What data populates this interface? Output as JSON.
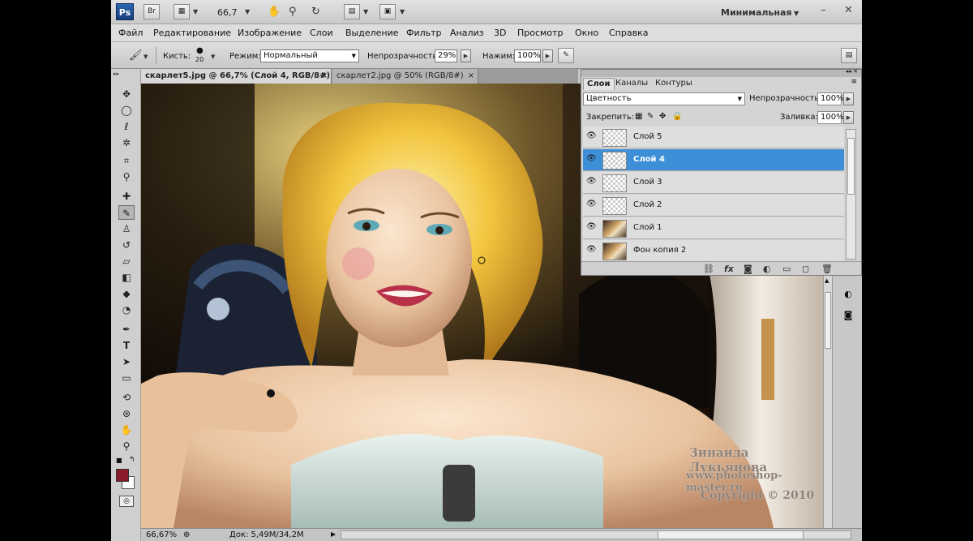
{
  "app": {
    "logo": "Ps",
    "bridge": "Br",
    "zoom": "66,7",
    "workspace": "Минимальная",
    "win_minimize": "–",
    "win_close": "✕"
  },
  "menu": [
    "Файл",
    "Редактирование",
    "Изображение",
    "Слои",
    "Выделение",
    "Фильтр",
    "Анализ",
    "3D",
    "Просмотр",
    "Окно",
    "Справка"
  ],
  "options": {
    "brush_label": "Кисть:",
    "brush_size": "20",
    "mode_label": "Режим:",
    "mode_value": "Нормальный",
    "opacity_label": "Непрозрачность:",
    "opacity_value": "29%",
    "flow_label": "Нажим:",
    "flow_value": "100%"
  },
  "doc_tabs": [
    {
      "label": "скарлет5.jpg @ 66,7% (Слой 4, RGB/8#) *",
      "close": "×"
    },
    {
      "label": "скарлет2.jpg @ 50% (RGB/8#)",
      "close": "×"
    }
  ],
  "layers_panel": {
    "tabs": [
      "Слои",
      "Каналы",
      "Контуры"
    ],
    "blend_mode": "Цветность",
    "opacity_label": "Непрозрачность:",
    "opacity_value": "100%",
    "lock_label": "Закрепить:",
    "fill_label": "Заливка:",
    "fill_value": "100%",
    "layers": [
      {
        "name": "Слой 5",
        "selected": false
      },
      {
        "name": "Слой 4",
        "selected": true
      },
      {
        "name": "Слой 3",
        "selected": false
      },
      {
        "name": "Слой 2",
        "selected": false
      },
      {
        "name": "Слой 1",
        "selected": false
      },
      {
        "name": "Фон копия 2",
        "selected": false
      }
    ]
  },
  "watermark": {
    "author": "Зинаида Лукьянова",
    "site": "www.photoshop-master.ru",
    "copyright": "Copyright © 2010"
  },
  "status": {
    "zoom": "66,67%",
    "doc_label": "Док: 5,49M/34,2M"
  },
  "colors": {
    "foreground": "#8b1a2b",
    "background": "#ffffff",
    "selection": "#3d8fd8"
  },
  "icons": [
    "move-icon",
    "marquee-icon",
    "lasso-icon",
    "magic-wand-icon",
    "crop-icon",
    "eyedropper-icon",
    "healing-icon",
    "brush-icon",
    "clone-stamp-icon",
    "history-brush-icon",
    "eraser-icon",
    "paint-bucket-icon",
    "blur-icon",
    "dodge-icon",
    "pen-icon",
    "type-icon",
    "path-select-icon",
    "shape-icon",
    "3d-rotate-icon",
    "3d-orbit-icon",
    "hand-icon",
    "zoom-icon"
  ]
}
